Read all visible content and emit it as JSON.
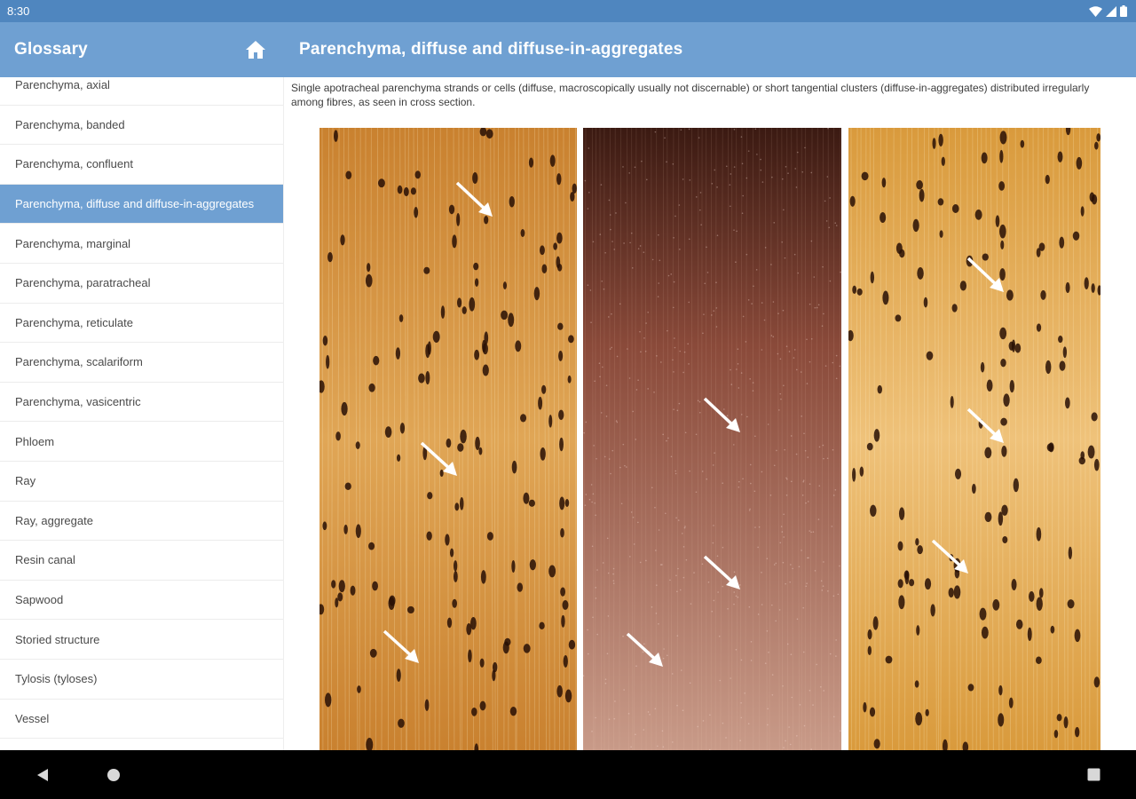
{
  "status_bar": {
    "time": "8:30",
    "icons": [
      "wifi-icon",
      "cell-signal-icon",
      "battery-icon"
    ]
  },
  "sidebar_header": {
    "title": "Glossary",
    "home_icon": "home-icon"
  },
  "header": {
    "title": "Parenchyma, diffuse and diffuse-in-aggregates"
  },
  "sidebar": {
    "selected_index": 3,
    "items": [
      {
        "label": "Parenchyma, axial"
      },
      {
        "label": "Parenchyma, banded"
      },
      {
        "label": "Parenchyma, confluent"
      },
      {
        "label": "Parenchyma, diffuse and diffuse-in-aggregates"
      },
      {
        "label": "Parenchyma, marginal"
      },
      {
        "label": "Parenchyma, paratracheal"
      },
      {
        "label": "Parenchyma, reticulate"
      },
      {
        "label": "Parenchyma, scalariform"
      },
      {
        "label": "Parenchyma, vasicentric"
      },
      {
        "label": "Phloem"
      },
      {
        "label": "Ray"
      },
      {
        "label": "Ray, aggregate"
      },
      {
        "label": "Resin canal"
      },
      {
        "label": "Sapwood"
      },
      {
        "label": "Storied structure"
      },
      {
        "label": "Tylosis (tyloses)"
      },
      {
        "label": "Vessel"
      }
    ]
  },
  "content": {
    "description": "Single apotracheal parenchyma strands or cells (diffuse, macroscopically usually not discernable) or short tangential clusters (diffuse-in-aggregates) distributed irregularly among fibres, as seen in cross section.",
    "images": [
      {
        "name": "wood-cross-section-1",
        "palette": [
          "#c9812f",
          "#e0a656",
          "#a8611f"
        ]
      },
      {
        "name": "wood-cross-section-2",
        "palette": [
          "#3b1a12",
          "#8a4a3a",
          "#c89a88"
        ]
      },
      {
        "name": "wood-cross-section-3",
        "palette": [
          "#d99a3c",
          "#efc27a",
          "#b97a2a"
        ]
      }
    ]
  },
  "nav_bar": {
    "icons": [
      "back-icon",
      "home-circle-icon",
      "recents-icon"
    ]
  },
  "colors": {
    "status_bar": "#4f86bf",
    "app_bar": "#6fa0d2",
    "selected_item": "#6fa0d2",
    "nav_bar": "#000000"
  }
}
